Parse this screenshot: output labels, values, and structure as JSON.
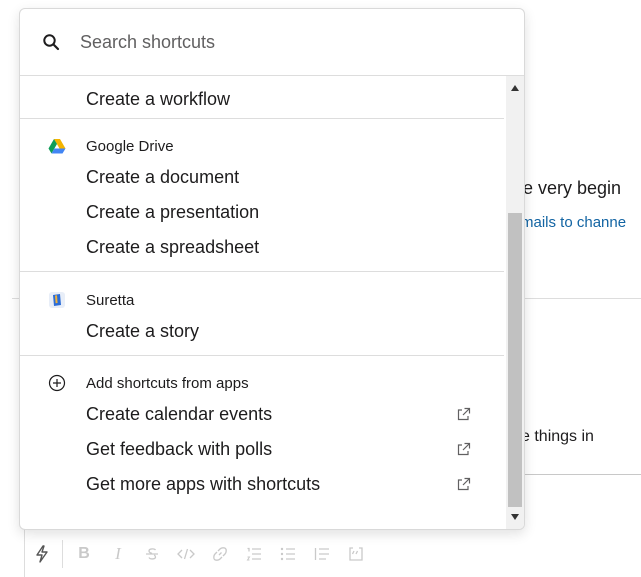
{
  "background": {
    "intro_text": "ne very begin",
    "link_text": "mails to channe",
    "hint_text": "e things in"
  },
  "search": {
    "placeholder": "Search shortcuts"
  },
  "sections": [
    {
      "items": [
        {
          "label": "Create a workflow"
        }
      ]
    },
    {
      "header": "Google Drive",
      "icon": "google-drive-icon",
      "items": [
        {
          "label": "Create a document"
        },
        {
          "label": "Create a presentation"
        },
        {
          "label": "Create a spreadsheet"
        }
      ]
    },
    {
      "header": "Suretta",
      "icon": "suretta-icon",
      "items": [
        {
          "label": "Create a story"
        }
      ]
    },
    {
      "header": "Add shortcuts from apps",
      "icon": "add-circle-icon",
      "items": [
        {
          "label": "Create calendar events",
          "external": true
        },
        {
          "label": "Get feedback with polls",
          "external": true
        },
        {
          "label": "Get more apps with shortcuts",
          "external": true
        }
      ]
    }
  ],
  "toolbar": {
    "buttons": [
      "shortcuts-icon",
      "bold-icon",
      "italic-icon",
      "strikethrough-icon",
      "code-icon",
      "link-icon",
      "ordered-list-icon",
      "bulleted-list-icon",
      "blockquote-icon",
      "code-block-icon"
    ],
    "bold_glyph": "B",
    "italic_glyph": "I"
  },
  "colors": {
    "link": "#1264a3",
    "text": "#1d1c1d",
    "muted": "#616061",
    "divider": "#dddddd",
    "scroll_thumb": "#c1c1c1"
  }
}
